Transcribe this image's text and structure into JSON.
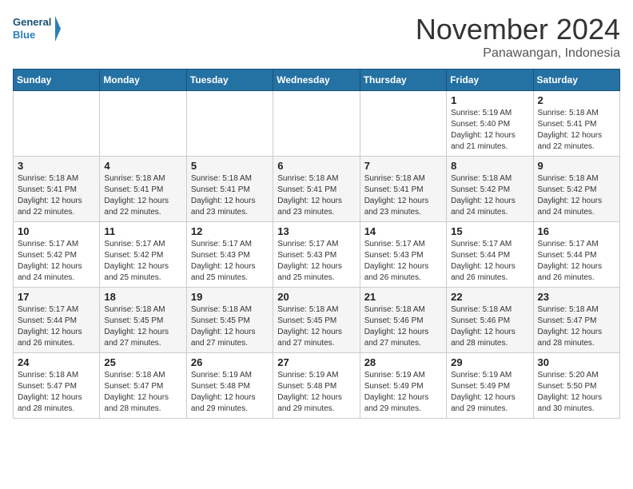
{
  "header": {
    "logo_line1": "General",
    "logo_line2": "Blue",
    "month": "November 2024",
    "location": "Panawangan, Indonesia"
  },
  "days_of_week": [
    "Sunday",
    "Monday",
    "Tuesday",
    "Wednesday",
    "Thursday",
    "Friday",
    "Saturday"
  ],
  "weeks": [
    [
      {
        "day": "",
        "info": ""
      },
      {
        "day": "",
        "info": ""
      },
      {
        "day": "",
        "info": ""
      },
      {
        "day": "",
        "info": ""
      },
      {
        "day": "",
        "info": ""
      },
      {
        "day": "1",
        "info": "Sunrise: 5:19 AM\nSunset: 5:40 PM\nDaylight: 12 hours\nand 21 minutes."
      },
      {
        "day": "2",
        "info": "Sunrise: 5:18 AM\nSunset: 5:41 PM\nDaylight: 12 hours\nand 22 minutes."
      }
    ],
    [
      {
        "day": "3",
        "info": "Sunrise: 5:18 AM\nSunset: 5:41 PM\nDaylight: 12 hours\nand 22 minutes."
      },
      {
        "day": "4",
        "info": "Sunrise: 5:18 AM\nSunset: 5:41 PM\nDaylight: 12 hours\nand 22 minutes."
      },
      {
        "day": "5",
        "info": "Sunrise: 5:18 AM\nSunset: 5:41 PM\nDaylight: 12 hours\nand 23 minutes."
      },
      {
        "day": "6",
        "info": "Sunrise: 5:18 AM\nSunset: 5:41 PM\nDaylight: 12 hours\nand 23 minutes."
      },
      {
        "day": "7",
        "info": "Sunrise: 5:18 AM\nSunset: 5:41 PM\nDaylight: 12 hours\nand 23 minutes."
      },
      {
        "day": "8",
        "info": "Sunrise: 5:18 AM\nSunset: 5:42 PM\nDaylight: 12 hours\nand 24 minutes."
      },
      {
        "day": "9",
        "info": "Sunrise: 5:18 AM\nSunset: 5:42 PM\nDaylight: 12 hours\nand 24 minutes."
      }
    ],
    [
      {
        "day": "10",
        "info": "Sunrise: 5:17 AM\nSunset: 5:42 PM\nDaylight: 12 hours\nand 24 minutes."
      },
      {
        "day": "11",
        "info": "Sunrise: 5:17 AM\nSunset: 5:42 PM\nDaylight: 12 hours\nand 25 minutes."
      },
      {
        "day": "12",
        "info": "Sunrise: 5:17 AM\nSunset: 5:43 PM\nDaylight: 12 hours\nand 25 minutes."
      },
      {
        "day": "13",
        "info": "Sunrise: 5:17 AM\nSunset: 5:43 PM\nDaylight: 12 hours\nand 25 minutes."
      },
      {
        "day": "14",
        "info": "Sunrise: 5:17 AM\nSunset: 5:43 PM\nDaylight: 12 hours\nand 26 minutes."
      },
      {
        "day": "15",
        "info": "Sunrise: 5:17 AM\nSunset: 5:44 PM\nDaylight: 12 hours\nand 26 minutes."
      },
      {
        "day": "16",
        "info": "Sunrise: 5:17 AM\nSunset: 5:44 PM\nDaylight: 12 hours\nand 26 minutes."
      }
    ],
    [
      {
        "day": "17",
        "info": "Sunrise: 5:17 AM\nSunset: 5:44 PM\nDaylight: 12 hours\nand 26 minutes."
      },
      {
        "day": "18",
        "info": "Sunrise: 5:18 AM\nSunset: 5:45 PM\nDaylight: 12 hours\nand 27 minutes."
      },
      {
        "day": "19",
        "info": "Sunrise: 5:18 AM\nSunset: 5:45 PM\nDaylight: 12 hours\nand 27 minutes."
      },
      {
        "day": "20",
        "info": "Sunrise: 5:18 AM\nSunset: 5:45 PM\nDaylight: 12 hours\nand 27 minutes."
      },
      {
        "day": "21",
        "info": "Sunrise: 5:18 AM\nSunset: 5:46 PM\nDaylight: 12 hours\nand 27 minutes."
      },
      {
        "day": "22",
        "info": "Sunrise: 5:18 AM\nSunset: 5:46 PM\nDaylight: 12 hours\nand 28 minutes."
      },
      {
        "day": "23",
        "info": "Sunrise: 5:18 AM\nSunset: 5:47 PM\nDaylight: 12 hours\nand 28 minutes."
      }
    ],
    [
      {
        "day": "24",
        "info": "Sunrise: 5:18 AM\nSunset: 5:47 PM\nDaylight: 12 hours\nand 28 minutes."
      },
      {
        "day": "25",
        "info": "Sunrise: 5:18 AM\nSunset: 5:47 PM\nDaylight: 12 hours\nand 28 minutes."
      },
      {
        "day": "26",
        "info": "Sunrise: 5:19 AM\nSunset: 5:48 PM\nDaylight: 12 hours\nand 29 minutes."
      },
      {
        "day": "27",
        "info": "Sunrise: 5:19 AM\nSunset: 5:48 PM\nDaylight: 12 hours\nand 29 minutes."
      },
      {
        "day": "28",
        "info": "Sunrise: 5:19 AM\nSunset: 5:49 PM\nDaylight: 12 hours\nand 29 minutes."
      },
      {
        "day": "29",
        "info": "Sunrise: 5:19 AM\nSunset: 5:49 PM\nDaylight: 12 hours\nand 29 minutes."
      },
      {
        "day": "30",
        "info": "Sunrise: 5:20 AM\nSunset: 5:50 PM\nDaylight: 12 hours\nand 30 minutes."
      }
    ]
  ]
}
